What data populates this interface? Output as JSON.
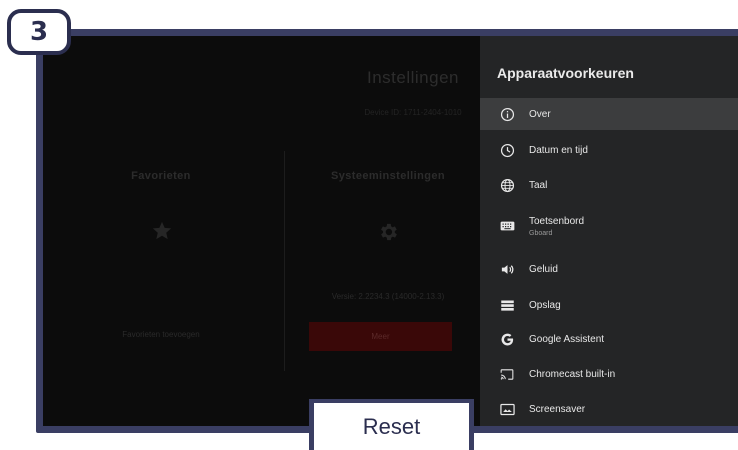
{
  "step": {
    "number": "3"
  },
  "background_screen": {
    "title": "Instellingen",
    "device_id": "Device ID: 1711-2404-1010",
    "favorites": {
      "title": "Favorieten",
      "icon": "star-icon",
      "button_label": "Favorieten toevoegen"
    },
    "system": {
      "title": "Systeeminstellingen",
      "icon": "gear-icon",
      "version": "Versie: 2.2234.3 (14000-2.13.3)",
      "button_label": "Meer"
    }
  },
  "panel": {
    "title": "Apparaatvoorkeuren",
    "items": [
      {
        "label": "Over",
        "sublabel": "",
        "icon": "info-icon",
        "selected": true
      },
      {
        "label": "Datum en tijd",
        "sublabel": "",
        "icon": "clock-icon",
        "selected": false
      },
      {
        "label": "Taal",
        "sublabel": "",
        "icon": "globe-icon",
        "selected": false
      },
      {
        "label": "Toetsenbord",
        "sublabel": "Gboard",
        "icon": "keyboard-icon",
        "selected": false
      },
      {
        "label": "Geluid",
        "sublabel": "",
        "icon": "volume-icon",
        "selected": false
      },
      {
        "label": "Opslag",
        "sublabel": "",
        "icon": "storage-icon",
        "selected": false
      },
      {
        "label": "Google Assistent",
        "sublabel": "",
        "icon": "google-icon",
        "selected": false
      },
      {
        "label": "Chromecast built-in",
        "sublabel": "",
        "icon": "cast-icon",
        "selected": false
      },
      {
        "label": "Screensaver",
        "sublabel": "",
        "icon": "screensaver-icon",
        "selected": false
      }
    ]
  },
  "reset_tab": {
    "label": "Reset"
  },
  "colors": {
    "frame": "#3a3e63",
    "panel": "#242526",
    "selected_row": "#3c3d3e",
    "meer_button": "#3a0808"
  }
}
